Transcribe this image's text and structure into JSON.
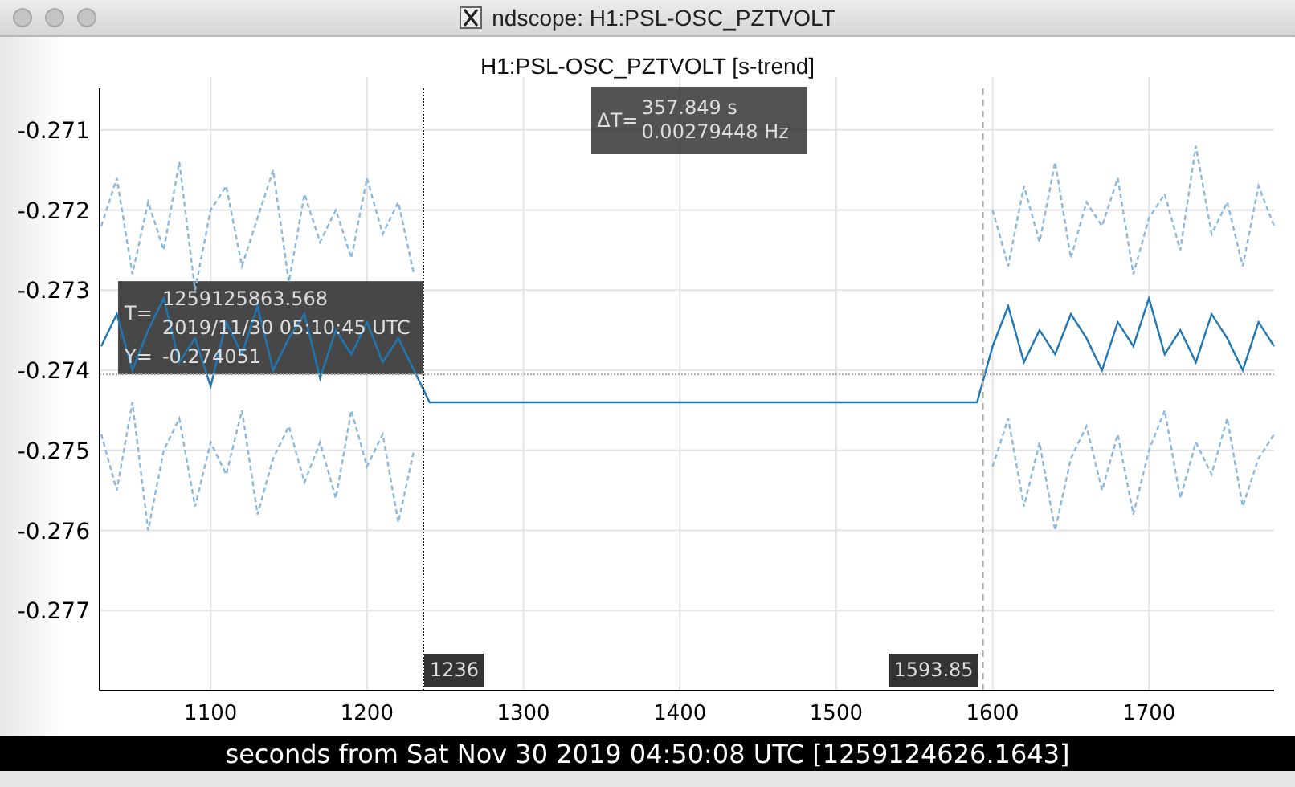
{
  "window": {
    "title": "ndscope: H1:PSL-OSC_PZTVOLT"
  },
  "plot": {
    "chart_data": {
      "type": "line",
      "title": "H1:PSL-OSC_PZTVOLT [s-trend]",
      "x": [
        1030,
        1040,
        1050,
        1060,
        1070,
        1080,
        1090,
        1100,
        1110,
        1120,
        1130,
        1140,
        1150,
        1160,
        1170,
        1180,
        1190,
        1200,
        1210,
        1220,
        1230,
        1240,
        1250,
        1260,
        1270,
        1280,
        1290,
        1300,
        1310,
        1320,
        1330,
        1340,
        1350,
        1360,
        1370,
        1380,
        1390,
        1400,
        1410,
        1420,
        1430,
        1440,
        1450,
        1460,
        1470,
        1480,
        1490,
        1500,
        1510,
        1520,
        1530,
        1540,
        1550,
        1560,
        1570,
        1580,
        1590,
        1600,
        1610,
        1620,
        1630,
        1640,
        1650,
        1660,
        1670,
        1680,
        1690,
        1700,
        1710,
        1720,
        1730,
        1740,
        1750,
        1760,
        1770,
        1780
      ],
      "series": [
        {
          "color": "#8ab8de",
          "line_style": "dashed",
          "values": [
            -0.2722,
            -0.2716,
            -0.2728,
            -0.2719,
            -0.2725,
            -0.2714,
            -0.273,
            -0.272,
            -0.2717,
            -0.2727,
            -0.2721,
            -0.2715,
            -0.2729,
            -0.2718,
            -0.2724,
            -0.272,
            -0.2726,
            -0.2716,
            -0.2723,
            -0.2719,
            -0.2728,
            null,
            null,
            null,
            null,
            null,
            null,
            null,
            null,
            null,
            null,
            null,
            null,
            null,
            null,
            null,
            null,
            null,
            null,
            null,
            null,
            null,
            null,
            null,
            null,
            null,
            null,
            null,
            null,
            null,
            null,
            null,
            null,
            null,
            null,
            null,
            null,
            -0.272,
            -0.2727,
            -0.2717,
            -0.2724,
            -0.2714,
            -0.2726,
            -0.2719,
            -0.2722,
            -0.2716,
            -0.2728,
            -0.2721,
            -0.2718,
            -0.2725,
            -0.2712,
            -0.2723,
            -0.2719,
            -0.2727,
            -0.2717,
            -0.2722
          ]
        },
        {
          "color": "#8ab8de",
          "line_style": "dashed",
          "values": [
            -0.2748,
            -0.2755,
            -0.2744,
            -0.276,
            -0.275,
            -0.2746,
            -0.2757,
            -0.2749,
            -0.2753,
            -0.2745,
            -0.2758,
            -0.2751,
            -0.2747,
            -0.2754,
            -0.2749,
            -0.2756,
            -0.2745,
            -0.2752,
            -0.2748,
            -0.2759,
            -0.275,
            null,
            null,
            null,
            null,
            null,
            null,
            null,
            null,
            null,
            null,
            null,
            null,
            null,
            null,
            null,
            null,
            null,
            null,
            null,
            null,
            null,
            null,
            null,
            null,
            null,
            null,
            null,
            null,
            null,
            null,
            null,
            null,
            null,
            null,
            null,
            null,
            -0.2752,
            -0.2746,
            -0.2757,
            -0.2749,
            -0.276,
            -0.2751,
            -0.2747,
            -0.2755,
            -0.2748,
            -0.2758,
            -0.275,
            -0.2745,
            -0.2756,
            -0.2749,
            -0.2753,
            -0.2746,
            -0.2757,
            -0.2751,
            -0.2748
          ]
        },
        {
          "color": "#1f77b4",
          "line_style": "solid",
          "values": [
            -0.2737,
            -0.2733,
            -0.274,
            -0.2735,
            -0.2731,
            -0.2739,
            -0.2736,
            -0.2742,
            -0.2734,
            -0.2738,
            -0.2732,
            -0.274,
            -0.2736,
            -0.2733,
            -0.2741,
            -0.2735,
            -0.2738,
            -0.2734,
            -0.2739,
            -0.2736,
            -0.274,
            -0.2744,
            -0.2744,
            -0.2744,
            -0.2744,
            -0.2744,
            -0.2744,
            -0.2744,
            -0.2744,
            -0.2744,
            -0.2744,
            -0.2744,
            -0.2744,
            -0.2744,
            -0.2744,
            -0.2744,
            -0.2744,
            -0.2744,
            -0.2744,
            -0.2744,
            -0.2744,
            -0.2744,
            -0.2744,
            -0.2744,
            -0.2744,
            -0.2744,
            -0.2744,
            -0.2744,
            -0.2744,
            -0.2744,
            -0.2744,
            -0.2744,
            -0.2744,
            -0.2744,
            -0.2744,
            -0.2744,
            -0.2744,
            -0.2737,
            -0.2732,
            -0.2739,
            -0.2735,
            -0.2738,
            -0.2733,
            -0.2736,
            -0.274,
            -0.2734,
            -0.2737,
            -0.2731,
            -0.2738,
            -0.2735,
            -0.2739,
            -0.2733,
            -0.2736,
            -0.274,
            -0.2734,
            -0.2737
          ]
        }
      ],
      "xlim": [
        1029,
        1780
      ],
      "ylim": [
        -0.278,
        -0.27048
      ],
      "xticks": [
        1100,
        1200,
        1300,
        1400,
        1500,
        1600,
        1700
      ],
      "yticks": [
        {
          "value": -0.271,
          "label": "-0.271"
        },
        {
          "value": -0.272,
          "label": "-0.272"
        },
        {
          "value": -0.273,
          "label": "-0.273"
        },
        {
          "value": -0.274,
          "label": "-0.274"
        },
        {
          "value": -0.275,
          "label": "-0.275"
        },
        {
          "value": -0.276,
          "label": "-0.276"
        },
        {
          "value": -0.277,
          "label": "-0.277"
        }
      ],
      "grid": true,
      "ref_lines": [
        {
          "axis": "x",
          "value": 1236,
          "label": "1236",
          "line_style": "dotted",
          "color": "#222222"
        },
        {
          "axis": "x",
          "value": 1593.85,
          "label": "1593.85",
          "line_style": "dashed",
          "color": "#aaaaaa"
        },
        {
          "axis": "y",
          "value": -0.274051,
          "label": "-0.274051",
          "line_style": "dotted",
          "color": "#aaaaaa"
        }
      ]
    },
    "cursor_readout": {
      "t_label": "T=",
      "t_value": "1259125863.568",
      "t_utc": "2019/11/30 05:10:45 UTC",
      "y_label": "Y="
    },
    "delta_readout": {
      "label": "ΔT=",
      "seconds": "357.849 s",
      "frequency": "0.00279448 Hz"
    },
    "xlabel": "seconds from Sat Nov 30 2019 04:50:08 UTC [1259124626.1643]"
  }
}
